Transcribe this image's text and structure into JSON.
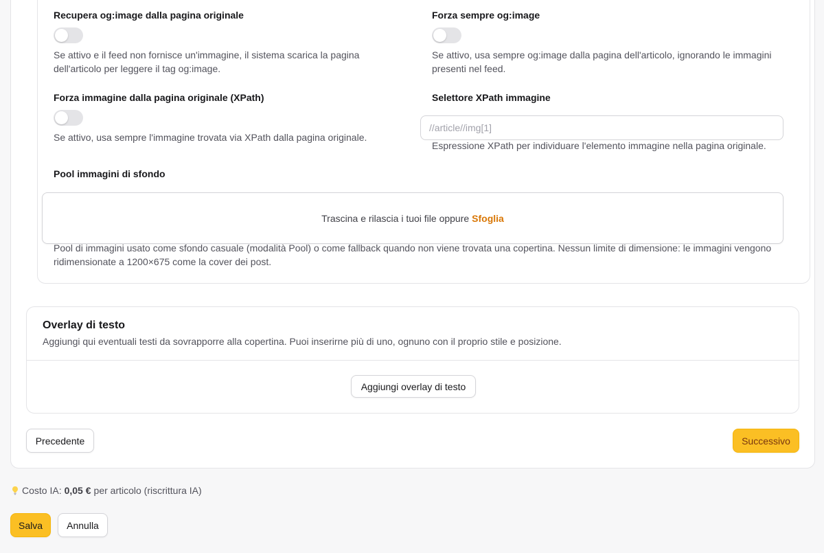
{
  "settings": {
    "og_fetch": {
      "label": "Recupera og:image dalla pagina originale",
      "enabled": false,
      "help": "Se attivo e il feed non fornisce un'immagine, il sistema scarica la pagina dell'articolo per leggere il tag og:image."
    },
    "og_force": {
      "label": "Forza sempre og:image",
      "enabled": false,
      "help": "Se attivo, usa sempre og:image dalla pagina dell'articolo, ignorando le immagini presenti nel feed."
    },
    "xpath_force": {
      "label": "Forza immagine dalla pagina originale (XPath)",
      "enabled": false,
      "help": "Se attivo, usa sempre l'immagine trovata via XPath dalla pagina originale."
    },
    "xpath_selector": {
      "label": "Selettore XPath immagine",
      "value": "",
      "placeholder": "//article//img[1]",
      "help": "Espressione XPath per individuare l'elemento immagine nella pagina originale."
    },
    "background_pool": {
      "label": "Pool immagini di sfondo",
      "drop_text": "Trascina e rilascia i tuoi file oppure",
      "browse_label": "Sfoglia",
      "help": "Pool di immagini usato come sfondo casuale (modalità Pool) o come fallback quando non viene trovata una copertina. Nessun limite di dimensione: le immagini vengono ridimensionate a 1200×675 come la cover dei post."
    }
  },
  "overlay": {
    "title": "Overlay di testo",
    "description": "Aggiungi qui eventuali testi da sovrapporre alla copertina. Puoi inserirne più di uno, ognuno con il proprio stile e posizione.",
    "add_label": "Aggiungi overlay di testo"
  },
  "wizard": {
    "prev_label": "Precedente",
    "next_label": "Successivo"
  },
  "cost": {
    "icon": "lightbulb-icon",
    "prefix": "Costo IA:",
    "amount": "0,05 €",
    "suffix": "per articolo (riscrittura IA)"
  },
  "footer": {
    "save_label": "Salva",
    "cancel_label": "Annulla"
  },
  "colors": {
    "accent": "#fbbf24",
    "link": "#d97706",
    "toggle_off": "#e4e4e7"
  }
}
